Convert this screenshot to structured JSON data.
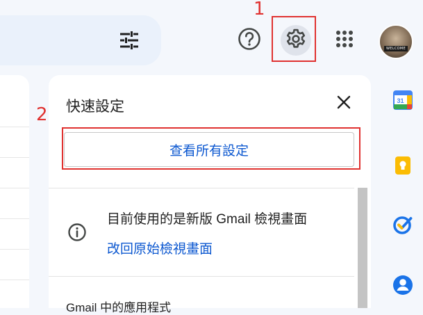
{
  "annotations": {
    "step_1": "1",
    "step_2": "2",
    "highlight_color": "#e0312f"
  },
  "header": {
    "icons": [
      "filter-tune-icon",
      "help-circle-icon",
      "gear-icon",
      "apps-grid-icon"
    ],
    "avatar_banner": "WELCOME"
  },
  "quick_settings": {
    "title": "快速設定",
    "see_all_label": "查看所有設定",
    "current_view_text": "目前使用的是新版 Gmail 檢視畫面",
    "revert_link": "改回原始檢視畫面",
    "apps_section_heading": "Gmail 中的應用程式"
  },
  "side_rail": {
    "items": [
      "google-calendar-icon",
      "google-keep-icon",
      "google-tasks-icon",
      "google-contacts-icon"
    ],
    "calendar_day": "31"
  },
  "colors": {
    "accent": "#0b57d0",
    "background": "#f4f7fc",
    "surface": "#ffffff"
  }
}
